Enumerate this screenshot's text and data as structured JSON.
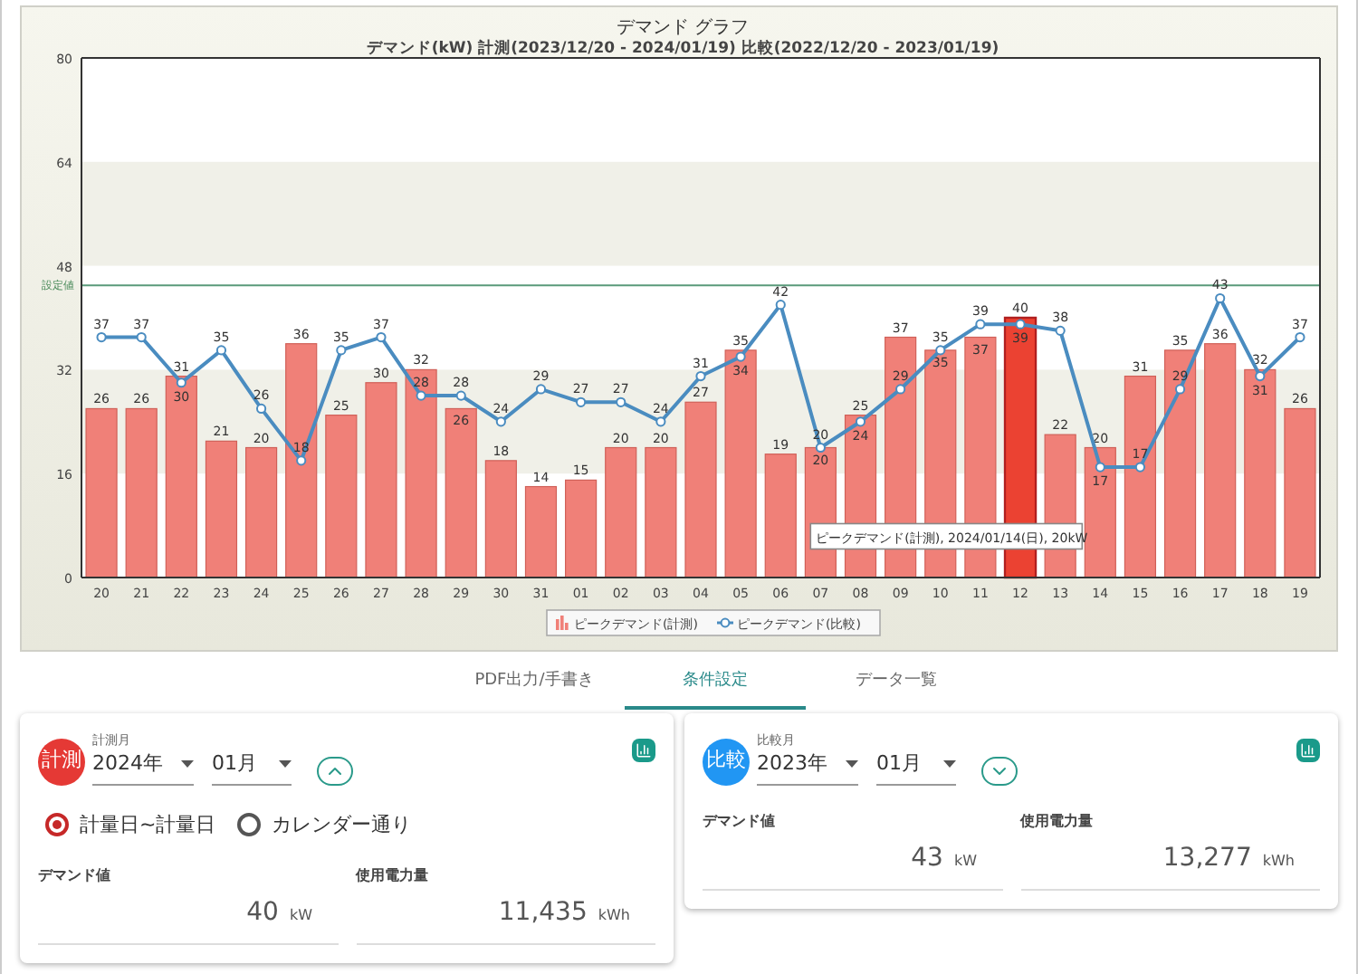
{
  "chart": {
    "chart_data": {
      "type": "bar",
      "title": "デマンド グラフ",
      "xlabel": "デマンド(kW) 計測(2023/12/20 - 2024/01/19) 比較(2022/12/20 - 2023/01/19)",
      "categories": [
        "20",
        "21",
        "22",
        "23",
        "24",
        "25",
        "26",
        "27",
        "28",
        "29",
        "30",
        "31",
        "01",
        "02",
        "03",
        "04",
        "05",
        "06",
        "07",
        "08",
        "09",
        "10",
        "11",
        "12",
        "13",
        "14",
        "15",
        "16",
        "17",
        "18",
        "19"
      ],
      "series": [
        {
          "name": "ピークデマンド(計測)",
          "color": "#f08078",
          "type": "bar",
          "values": [
            26,
            26,
            31,
            21,
            20,
            36,
            25,
            30,
            32,
            26,
            18,
            14,
            15,
            20,
            20,
            27,
            35,
            19,
            20,
            25,
            37,
            35,
            37,
            40,
            22,
            20,
            31,
            35,
            36,
            32,
            26
          ]
        },
        {
          "name": "ピークデマンド(比較)",
          "color": "#4a8cc0",
          "type": "line",
          "marker": "circle",
          "values": [
            37,
            37,
            30,
            35,
            26,
            18,
            35,
            37,
            28,
            28,
            24,
            29,
            27,
            27,
            24,
            31,
            34,
            42,
            20,
            24,
            29,
            35,
            39,
            39,
            38,
            17,
            17,
            29,
            43,
            31,
            37
          ]
        }
      ],
      "ylim": [
        0,
        80
      ],
      "yticks": [
        0,
        16,
        32,
        48,
        64,
        80
      ],
      "data_labels": true,
      "legend": true,
      "ref_lines": [
        {
          "axis": "y",
          "value": 45,
          "label": "設定値",
          "color": "#5a9a7a"
        }
      ]
    },
    "bars": [
      {
        "highlighted": false
      },
      {
        "highlighted": false
      },
      {
        "highlighted": false
      },
      {
        "highlighted": false
      },
      {
        "highlighted": false
      },
      {
        "highlighted": false
      },
      {
        "highlighted": false
      },
      {
        "highlighted": false
      },
      {
        "highlighted": false
      },
      {
        "highlighted": false
      },
      {
        "highlighted": false
      },
      {
        "highlighted": false
      },
      {
        "highlighted": false
      },
      {
        "highlighted": false
      },
      {
        "highlighted": false
      },
      {
        "highlighted": false
      },
      {
        "highlighted": false
      },
      {
        "highlighted": false
      },
      {
        "highlighted": false
      },
      {
        "highlighted": false
      },
      {
        "highlighted": false
      },
      {
        "highlighted": false
      },
      {
        "highlighted": false
      },
      {
        "highlighted": true
      },
      {
        "highlighted": false
      },
      {
        "highlighted": false
      },
      {
        "highlighted": false
      },
      {
        "highlighted": false
      },
      {
        "highlighted": false
      },
      {
        "highlighted": false
      },
      {
        "highlighted": false
      }
    ],
    "tooltip": {
      "text": "ピークデマンド(計測), 2024/01/14(日), 20kW"
    }
  },
  "tabs": [
    {
      "label": "PDF出力/手書き",
      "selected": false
    },
    {
      "label": "条件設定",
      "selected": true
    },
    {
      "label": "データ一覧",
      "selected": false
    }
  ],
  "cards": [
    {
      "badge": "計測",
      "color": "#e53935",
      "month_label": "計測月",
      "year": "2024年",
      "month": "01月",
      "expanded": true,
      "radios": [
        {
          "label": "計量日~計量日",
          "selected": true
        },
        {
          "label": "カレンダー通り",
          "selected": false
        }
      ],
      "fields": [
        {
          "label": "デマンド値",
          "value": "40",
          "unit": "kW"
        },
        {
          "label": "使用電力量",
          "value": "11,435",
          "unit": "kWh"
        }
      ]
    },
    {
      "badge": "比較",
      "color": "#2196f3",
      "month_label": "比較月",
      "year": "2023年",
      "month": "01月",
      "expanded": false,
      "fields": [
        {
          "label": "デマンド値",
          "value": "43",
          "unit": "kW"
        },
        {
          "label": "使用電力量",
          "value": "13,277",
          "unit": "kWh"
        }
      ]
    }
  ]
}
